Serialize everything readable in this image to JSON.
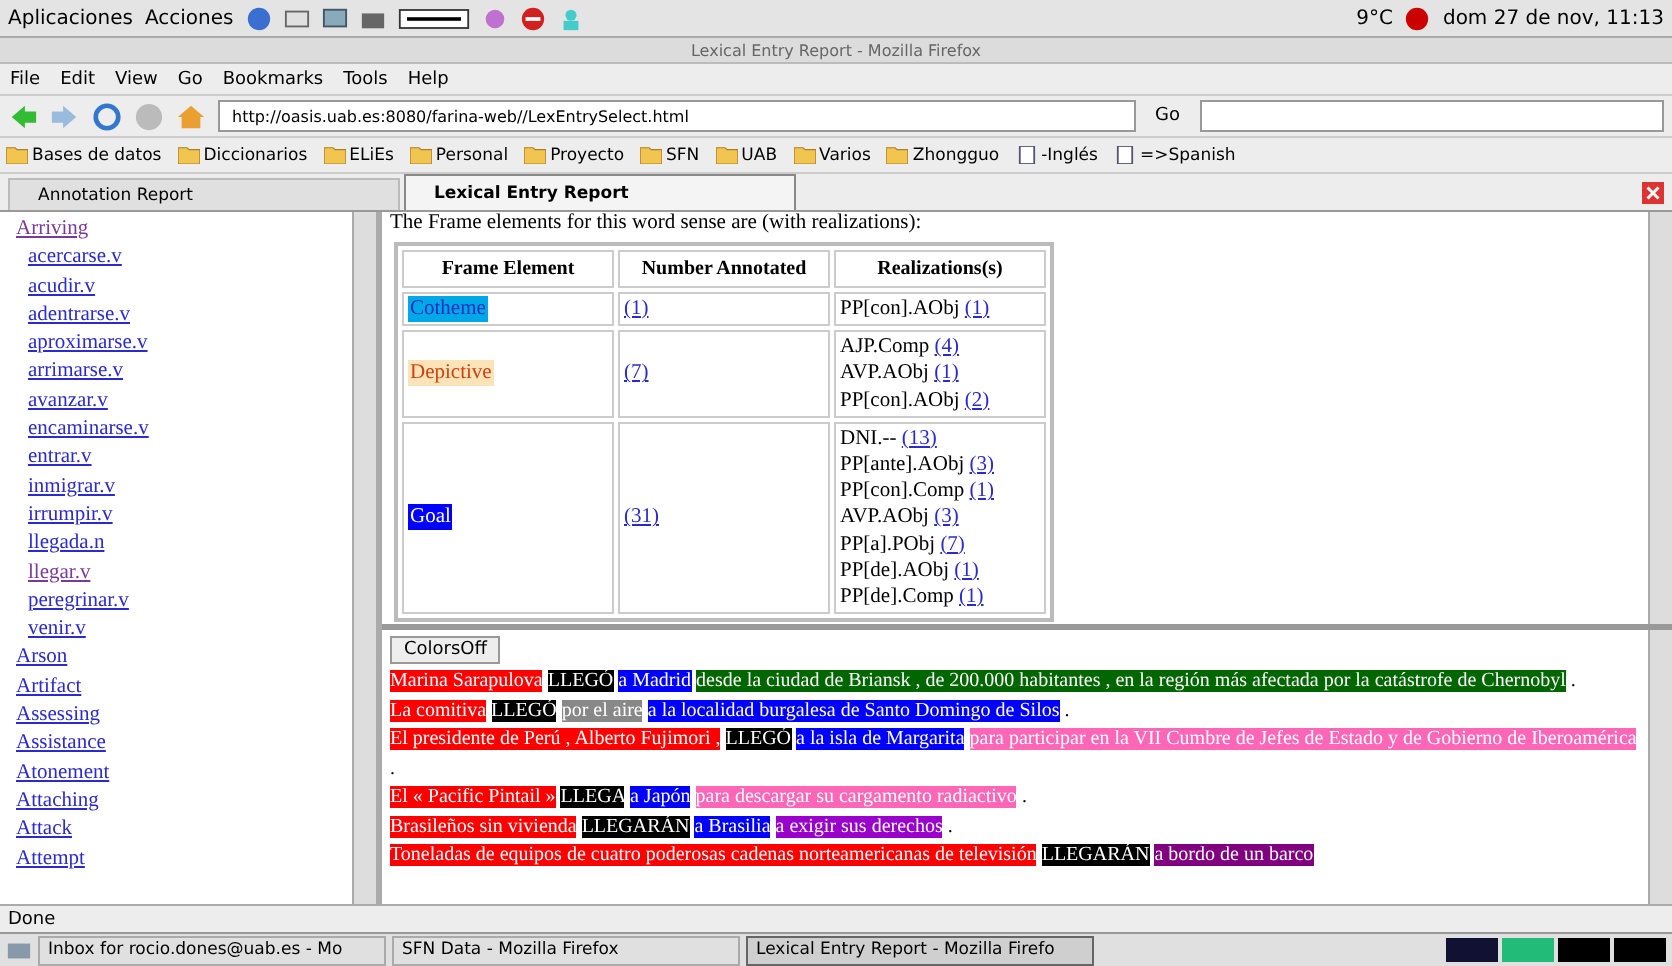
{
  "panel": {
    "menus": [
      "Aplicaciones",
      "Acciones"
    ],
    "weather": "9°C",
    "clock": "dom 27 de nov, 11:13"
  },
  "window": {
    "title": "Lexical Entry Report - Mozilla Firefox"
  },
  "menubar": [
    "File",
    "Edit",
    "View",
    "Go",
    "Bookmarks",
    "Tools",
    "Help"
  ],
  "toolbar": {
    "url": "http://oasis.uab.es:8080/farina-web//LexEntrySelect.html",
    "go": "Go"
  },
  "bookmarks": [
    {
      "label": "Bases de datos",
      "kind": "folder"
    },
    {
      "label": "Diccionarios",
      "kind": "folder"
    },
    {
      "label": "ELiEs",
      "kind": "folder"
    },
    {
      "label": "Personal",
      "kind": "folder"
    },
    {
      "label": "Proyecto",
      "kind": "folder"
    },
    {
      "label": "SFN",
      "kind": "folder"
    },
    {
      "label": "UAB",
      "kind": "folder"
    },
    {
      "label": "Varios",
      "kind": "folder"
    },
    {
      "label": "Zhongguo",
      "kind": "folder"
    },
    {
      "label": "-Inglés",
      "kind": "page"
    },
    {
      "label": "=>Spanish",
      "kind": "page"
    }
  ],
  "tabs": [
    {
      "label": "Annotation Report",
      "selected": false
    },
    {
      "label": "Lexical Entry Report",
      "selected": true
    }
  ],
  "sidebar": {
    "items": [
      {
        "label": "Arriving",
        "visited": true,
        "children": [
          {
            "label": "acercarse.v",
            "visited": false
          },
          {
            "label": "acudir.v",
            "visited": false
          },
          {
            "label": "adentrarse.v",
            "visited": false
          },
          {
            "label": "aproximarse.v",
            "visited": false
          },
          {
            "label": "arrimarse.v",
            "visited": false
          },
          {
            "label": "avanzar.v",
            "visited": false
          },
          {
            "label": "encaminarse.v",
            "visited": false
          },
          {
            "label": "entrar.v",
            "visited": false
          },
          {
            "label": "inmigrar.v",
            "visited": false
          },
          {
            "label": "irrumpir.v",
            "visited": false
          },
          {
            "label": "llegada.n",
            "visited": false
          },
          {
            "label": "llegar.v",
            "visited": true
          },
          {
            "label": "peregrinar.v",
            "visited": false
          },
          {
            "label": "venir.v",
            "visited": false
          }
        ]
      },
      {
        "label": "Arson",
        "visited": false
      },
      {
        "label": "Artifact",
        "visited": false
      },
      {
        "label": "Assessing",
        "visited": false
      },
      {
        "label": "Assistance",
        "visited": false
      },
      {
        "label": "Atonement",
        "visited": false
      },
      {
        "label": "Attaching",
        "visited": false
      },
      {
        "label": "Attack",
        "visited": false
      },
      {
        "label": "Attempt",
        "visited": false
      }
    ]
  },
  "report": {
    "intro": "The Frame elements for this word sense are (with realizations):",
    "columns": [
      "Frame Element",
      "Number Annotated",
      "Realizations(s)"
    ],
    "rows": [
      {
        "element": "Cotheme",
        "color": "#00a8e8",
        "count": "(1)",
        "realizations": [
          {
            "text": "PP[con].AObj",
            "count": "(1)"
          }
        ]
      },
      {
        "element": "Depictive",
        "color": "#fde3b8",
        "count": "(7)",
        "realizations": [
          {
            "text": "AJP.Comp",
            "count": "(4)"
          },
          {
            "text": "AVP.AObj",
            "count": "(1)"
          },
          {
            "text": "PP[con].AObj",
            "count": "(2)"
          }
        ]
      },
      {
        "element": "Goal",
        "color": "#0000ff",
        "count": "(31)",
        "realizations": [
          {
            "text": "DNI.--",
            "count": "(13)"
          },
          {
            "text": "PP[ante].AObj",
            "count": "(3)"
          },
          {
            "text": "PP[con].Comp",
            "count": "(1)"
          },
          {
            "text": "AVP.AObj",
            "count": "(3)"
          },
          {
            "text": "PP[a].PObj",
            "count": "(7)"
          },
          {
            "text": "PP[de].AObj",
            "count": "(1)"
          },
          {
            "text": "PP[de].Comp",
            "count": "(1)"
          }
        ]
      }
    ]
  },
  "sentences": {
    "button": "ColorsOff",
    "items": [
      [
        {
          "text": "Marina Sarapulova",
          "color": "#ff0000"
        },
        {
          "text": "LLEGÓ",
          "color": "#000000"
        },
        {
          "text": "a Madrid",
          "color": "#0000ff"
        },
        {
          "text": "desde la ciudad de Briansk , de 200.000 habitantes , en la región más afectada por la catástrofe de Chernobyl",
          "color": "#006600"
        },
        {
          "text": "."
        }
      ],
      [
        {
          "text": "La comitiva",
          "color": "#ff0000"
        },
        {
          "text": "LLEGÓ",
          "color": "#000000"
        },
        {
          "text": "por el aire",
          "color": "#888888"
        },
        {
          "text": "a la localidad burgalesa de Santo Domingo de Silos",
          "color": "#0000ff"
        },
        {
          "text": "."
        }
      ],
      [
        {
          "text": "El presidente de Perú , Alberto Fujimori ,",
          "color": "#ff0000"
        },
        {
          "text": "LLEGÓ",
          "color": "#000000"
        },
        {
          "text": "a la isla de Margarita",
          "color": "#0000ff"
        },
        {
          "text": "para participar en la VII Cumbre de Jefes de Estado y de Gobierno de Iberoamérica",
          "color": "#ff66b8"
        },
        {
          "text": "."
        }
      ],
      [
        {
          "text": "El « Pacific Pintail »",
          "color": "#ff0000"
        },
        {
          "text": "LLEGA",
          "color": "#000000"
        },
        {
          "text": "a Japón",
          "color": "#0000ff"
        },
        {
          "text": "para descargar su cargamento radiactivo",
          "color": "#ff66b8"
        },
        {
          "text": "."
        }
      ],
      [
        {
          "text": "Brasileños sin vivienda",
          "color": "#ff0000"
        },
        {
          "text": "LLEGARÁN",
          "color": "#000000"
        },
        {
          "text": "a Brasilia",
          "color": "#0000ff"
        },
        {
          "text": "a exigir sus derechos",
          "color": "#9900cc"
        },
        {
          "text": "."
        }
      ],
      [
        {
          "text": "Toneladas de equipos de cuatro poderosas cadenas norteamericanas de televisión",
          "color": "#ff0000"
        },
        {
          "text": "LLEGARÁN",
          "color": "#000000"
        },
        {
          "text": "a bordo de un barco",
          "color": "#800080"
        }
      ]
    ]
  },
  "status_bar": "Done",
  "taskbar": [
    {
      "label": "Inbox for rocio.dones@uab.es - Mo",
      "selected": false
    },
    {
      "label": "SFN Data - Mozilla Firefox",
      "selected": false
    },
    {
      "label": "Lexical Entry Report - Mozilla Firefo",
      "selected": true
    }
  ]
}
